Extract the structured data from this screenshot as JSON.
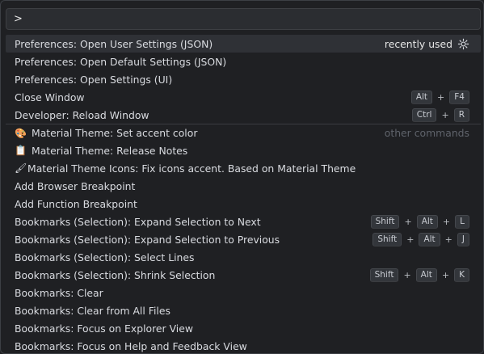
{
  "input": {
    "value": ">"
  },
  "items": [
    {
      "label": "Preferences: Open User Settings (JSON)",
      "hint": "recently used",
      "icon": "gear-icon"
    },
    {
      "label": "Preferences: Open Default Settings (JSON)"
    },
    {
      "label": "Preferences: Open Settings (UI)"
    },
    {
      "label": "Close Window",
      "keys": [
        "Alt",
        "F4"
      ]
    },
    {
      "label": "Developer: Reload Window",
      "keys": [
        "Ctrl",
        "R"
      ]
    },
    {
      "label": "Material Theme: Set accent color",
      "group": "other commands",
      "icon": "palette-icon"
    },
    {
      "label": "Material Theme: Release Notes",
      "icon": "notes-icon"
    },
    {
      "label": "Material Theme Icons: Fix icons accent. Based on Material Theme",
      "icon": "brush-icon"
    },
    {
      "label": "Add Browser Breakpoint"
    },
    {
      "label": "Add Function Breakpoint"
    },
    {
      "label": "Bookmarks (Selection): Expand Selection to Next",
      "keys": [
        "Shift",
        "Alt",
        "L"
      ]
    },
    {
      "label": "Bookmarks (Selection): Expand Selection to Previous",
      "keys": [
        "Shift",
        "Alt",
        "J"
      ]
    },
    {
      "label": "Bookmarks (Selection): Select Lines"
    },
    {
      "label": "Bookmarks (Selection): Shrink Selection",
      "keys": [
        "Shift",
        "Alt",
        "K"
      ]
    },
    {
      "label": "Bookmarks: Clear"
    },
    {
      "label": "Bookmarks: Clear from All Files"
    },
    {
      "label": "Bookmarks: Focus on Explorer View"
    },
    {
      "label": "Bookmarks: Focus on Help and Feedback View"
    }
  ],
  "plus_symbol": "+"
}
